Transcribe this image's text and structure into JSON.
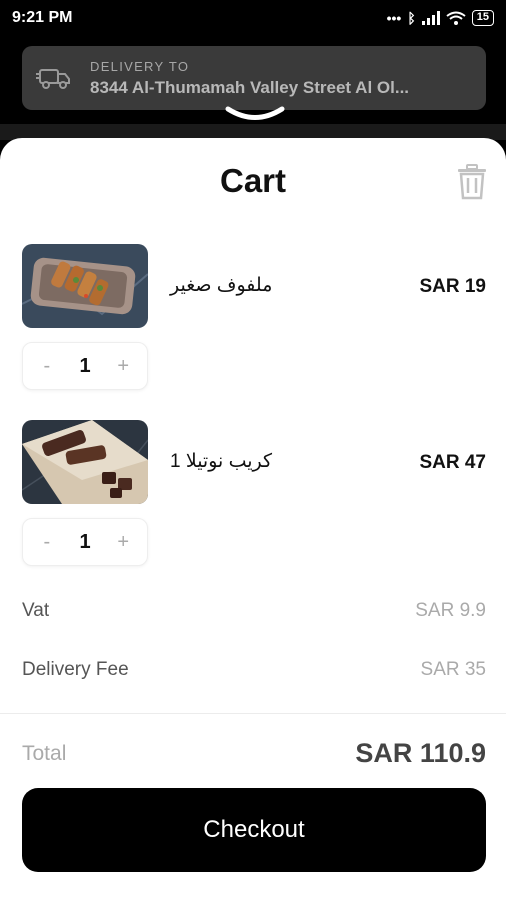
{
  "status_bar": {
    "time": "9:21 PM",
    "battery": "15"
  },
  "delivery": {
    "label": "DELIVERY TO",
    "address": "8344 Al-Thumamah Valley Street Al Ol..."
  },
  "cart": {
    "title": "Cart"
  },
  "items": [
    {
      "name": "ملفوف صغير",
      "price": "SAR 19",
      "qty": "1",
      "minus": "-",
      "plus": "+"
    },
    {
      "name": "كريب نوتيلا 1",
      "price": "SAR 47",
      "qty": "1",
      "minus": "-",
      "plus": "+"
    }
  ],
  "fees": {
    "vat_label": "Vat",
    "vat_value": "SAR 9.9",
    "delivery_label": "Delivery Fee",
    "delivery_value": "SAR 35"
  },
  "total": {
    "label": "Total",
    "value": "SAR 110.9"
  },
  "checkout": {
    "label": "Checkout"
  }
}
